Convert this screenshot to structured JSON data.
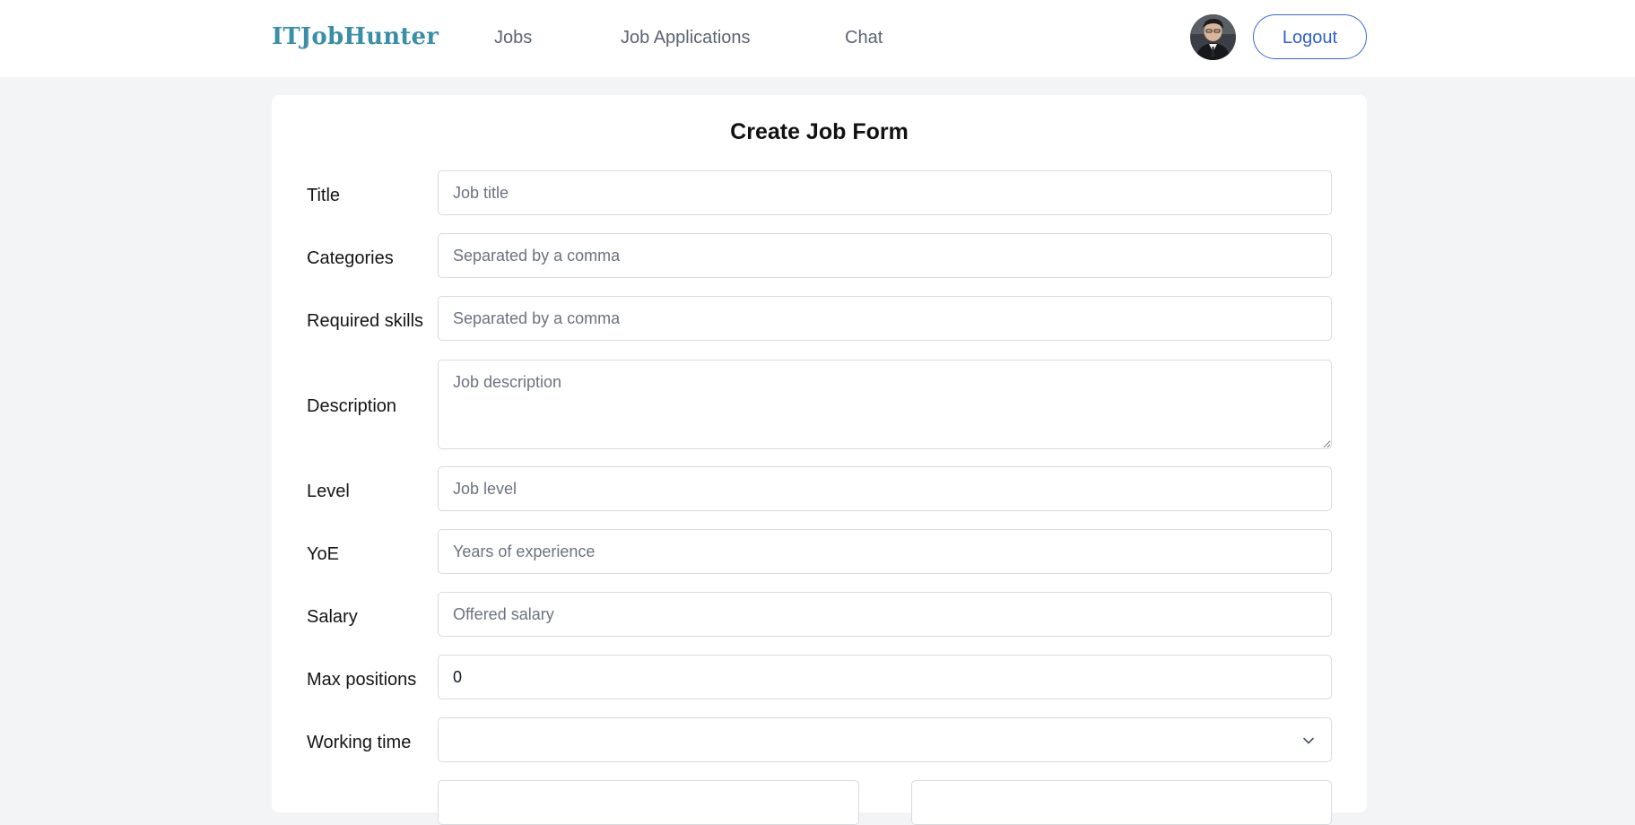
{
  "navbar": {
    "brand": "ITJobHunter",
    "links": {
      "jobs": "Jobs",
      "job_applications": "Job Applications",
      "chat": "Chat"
    },
    "logout_label": "Logout"
  },
  "form": {
    "title": "Create Job Form",
    "fields": {
      "title": {
        "label": "Title",
        "placeholder": "Job title",
        "value": ""
      },
      "categories": {
        "label": "Categories",
        "placeholder": "Separated by a comma",
        "value": ""
      },
      "required_skills": {
        "label": "Required skills",
        "placeholder": "Separated by a comma",
        "value": ""
      },
      "description": {
        "label": "Description",
        "placeholder": "Job description",
        "value": ""
      },
      "level": {
        "label": "Level",
        "placeholder": "Job level",
        "value": ""
      },
      "yoe": {
        "label": "YoE",
        "placeholder": "Years of experience",
        "value": ""
      },
      "salary": {
        "label": "Salary",
        "placeholder": "Offered salary",
        "value": ""
      },
      "max_positions": {
        "label": "Max positions",
        "placeholder": "",
        "value": "0"
      },
      "working_time": {
        "label": "Working time",
        "selected": ""
      }
    }
  },
  "colors": {
    "brand": "#3a8fa8",
    "accent": "#2f5fd4",
    "page_background": "#f3f4f6",
    "field_border": "#d7dbe0"
  },
  "icons": {
    "select_caret": "chevron-down-icon",
    "profile": "avatar"
  }
}
